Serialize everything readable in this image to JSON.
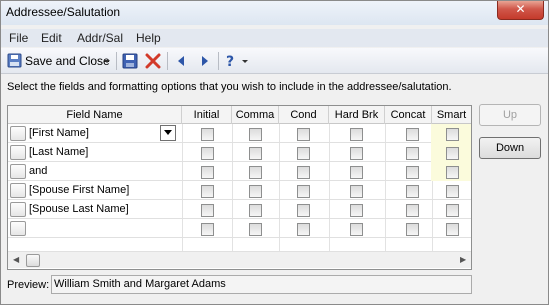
{
  "window": {
    "title": "Addressee/Salutation",
    "close_glyph": "✕"
  },
  "menu": [
    "File",
    "Edit",
    "Addr/Sal",
    "Help"
  ],
  "toolbar": {
    "save_close_label": "Save and Close",
    "icons": [
      "save-close-icon",
      "dropdown-arrow-icon",
      "save-icon",
      "delete-icon",
      "previous-icon",
      "next-icon",
      "help-icon",
      "help-dropdown-icon"
    ]
  },
  "instruction": "Select the fields and formatting options that you wish to include in the addressee/salutation.",
  "grid": {
    "columns": [
      "Field Name",
      "Initial",
      "Comma",
      "Cond",
      "Hard Brk",
      "Concat",
      "Smart"
    ],
    "rows": [
      {
        "field": "[First Name]",
        "has_combo": true
      },
      {
        "field": "[Last Name]"
      },
      {
        "field": "and"
      },
      {
        "field": "[Spouse First Name]"
      },
      {
        "field": "[Spouse Last Name]"
      },
      {
        "field": ""
      }
    ]
  },
  "buttons": {
    "up": "Up",
    "down": "Down"
  },
  "preview": {
    "label": "Preview:",
    "value": "William Smith and Margaret Adams"
  }
}
